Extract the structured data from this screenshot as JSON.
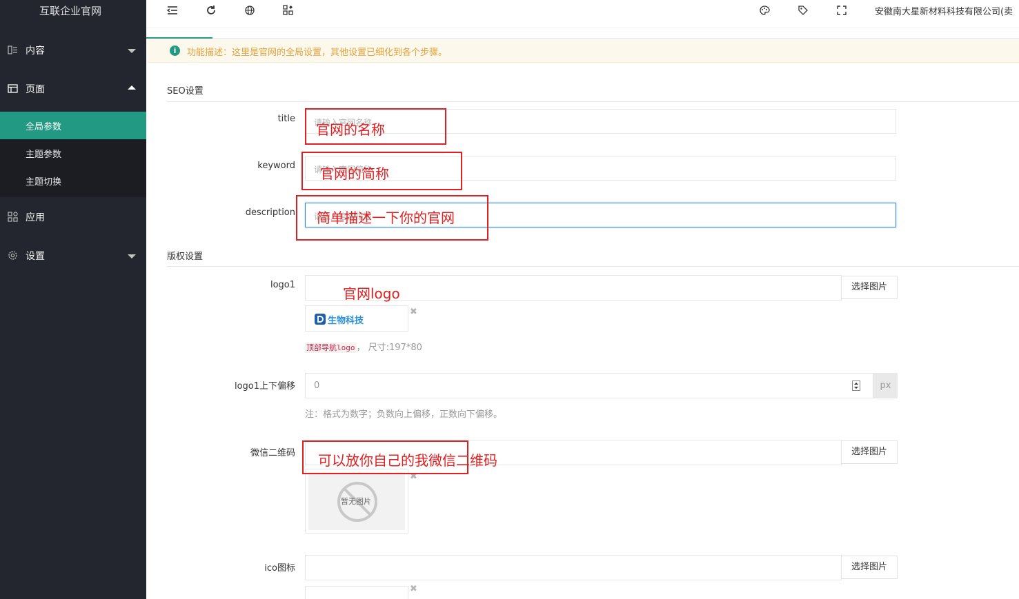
{
  "sidebar": {
    "title": "互联企业官网",
    "menu": [
      {
        "label": "内容",
        "icon": "content-icon"
      },
      {
        "label": "页面",
        "icon": "page-icon"
      },
      {
        "label": "应用",
        "icon": "app-icon"
      },
      {
        "label": "设置",
        "icon": "gear-icon"
      }
    ],
    "submenu": [
      {
        "label": "全局参数",
        "active": true
      },
      {
        "label": "主题参数"
      },
      {
        "label": "主题切换"
      }
    ]
  },
  "topbar": {
    "icons": [
      "menu-fold-icon",
      "refresh-icon",
      "globe-icon",
      "apps-icon",
      "palette-icon",
      "tag-icon",
      "fullscreen-icon"
    ],
    "company": "安徽南大星新材料科技有限公司(卖"
  },
  "notice": {
    "text": "功能描述：这里是官网的全局设置，其他设置已细化到各个步骤。"
  },
  "seo": {
    "section_title": "SEO设置",
    "title_label": "title",
    "title_placeholder": "请输入官网名称",
    "keyword_label": "keyword",
    "keyword_placeholder": "请输入官网简称",
    "description_label": "description",
    "description_placeholder": "请输入官网描述"
  },
  "copyright": {
    "section_title": "版权设置",
    "logo1_label": "logo1",
    "pick_button": "选择图片",
    "logo_image_text": "生物科技",
    "logo_hint_code": "顶部导航logo",
    "logo_hint_text": "，  尺寸:197*80",
    "offset_label": "logo1上下偏移",
    "offset_value": "0",
    "offset_unit": "px",
    "offset_hint": "注：格式为数字；负数向上偏移，正数向下偏移。",
    "wechat_label": "微信二维码",
    "no_image_text": "暂无图片",
    "ico_label": "ico图标"
  },
  "annotations": {
    "title": "官网的名称",
    "keyword": "官网的简称",
    "description": "简单描述一下你的官网",
    "logo": "官网logo",
    "wechat": "可以放你自己的我微信二维码"
  },
  "colors": {
    "accent": "#229a83",
    "sidebar": "#23262e",
    "annotation": "#e02020",
    "notice": "#e6a23c"
  }
}
